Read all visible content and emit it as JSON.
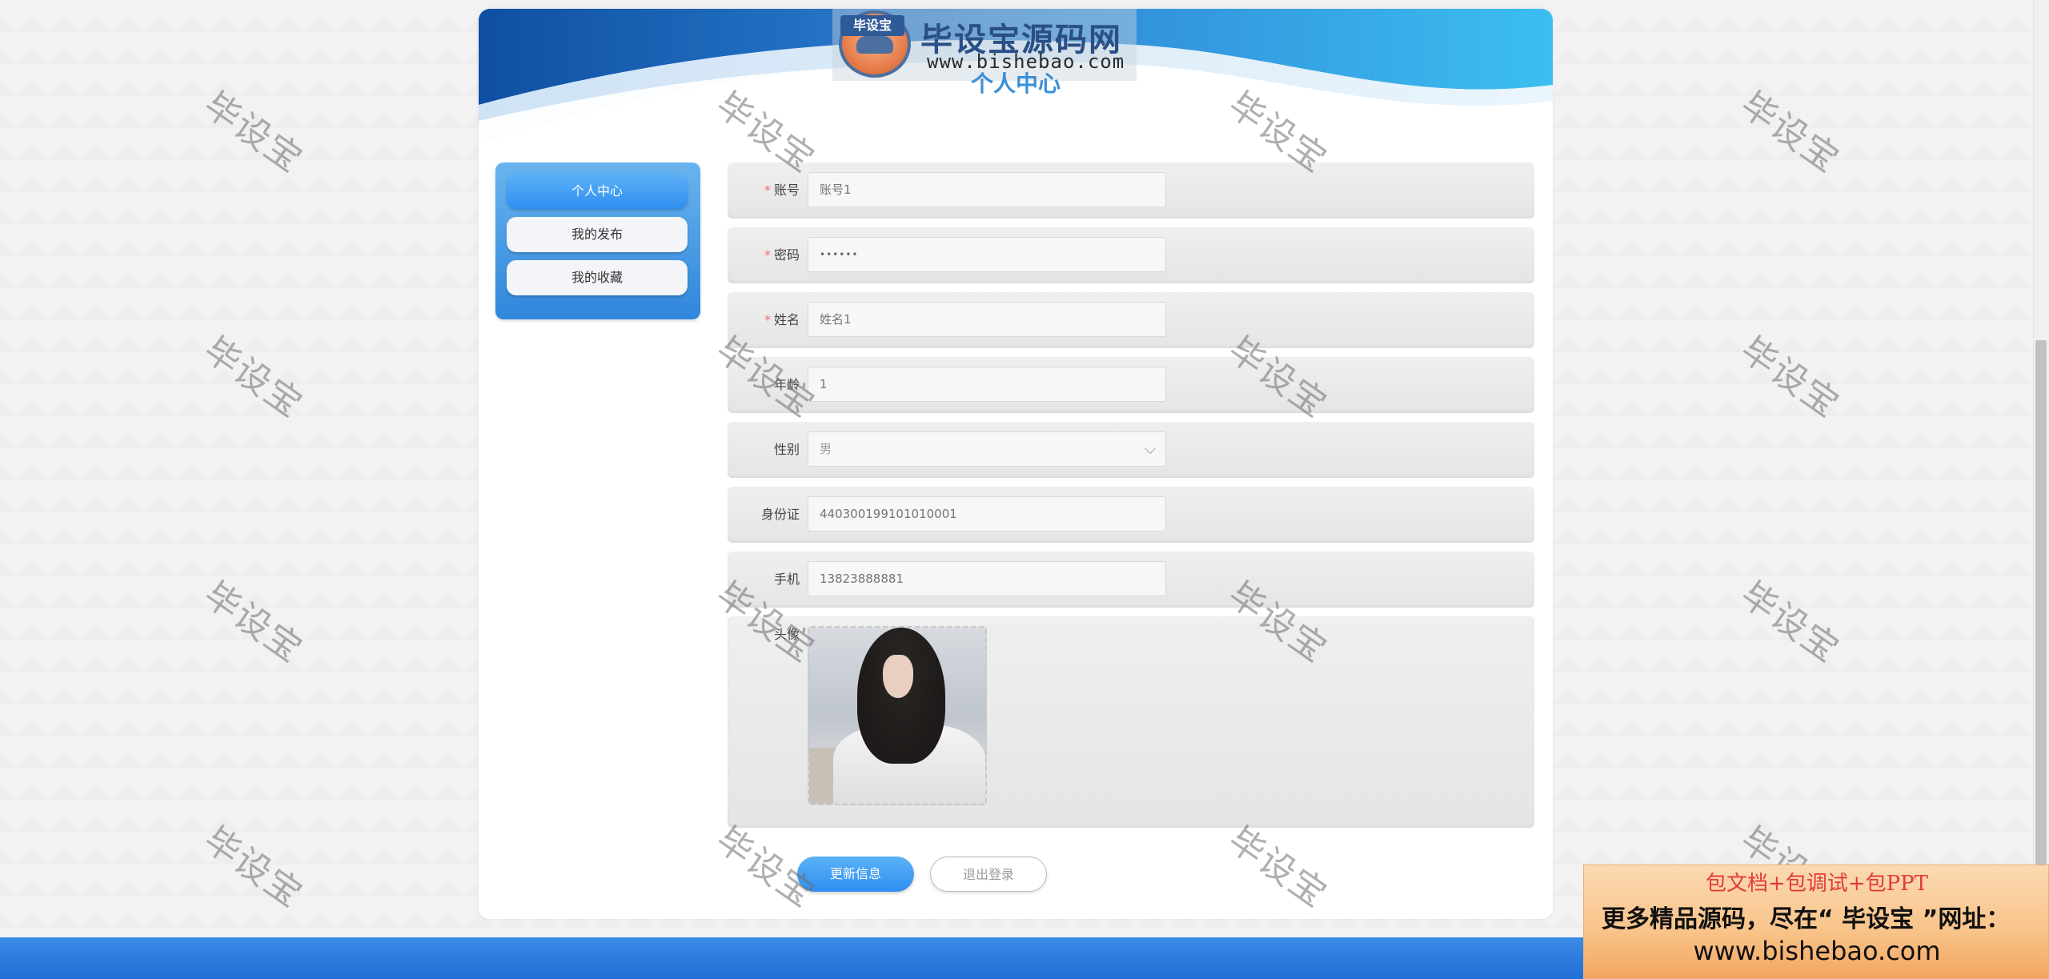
{
  "logo": {
    "tag": "毕设宝",
    "title": "毕设宝源码网",
    "url": "www.bishebao.com"
  },
  "page_title": "个人中心",
  "sidebar": {
    "items": [
      {
        "label": "个人中心",
        "active": true
      },
      {
        "label": "我的发布",
        "active": false
      },
      {
        "label": "我的收藏",
        "active": false
      }
    ]
  },
  "form": {
    "account": {
      "label": "账号",
      "required": true,
      "value": "账号1"
    },
    "password": {
      "label": "密码",
      "required": true,
      "value": "••••••"
    },
    "name": {
      "label": "姓名",
      "required": true,
      "value": "姓名1"
    },
    "age": {
      "label": "年龄",
      "required": false,
      "value": "1"
    },
    "gender": {
      "label": "性别",
      "required": false,
      "value": "男"
    },
    "idcard": {
      "label": "身份证",
      "required": false,
      "value": "440300199101010001"
    },
    "phone": {
      "label": "手机",
      "required": false,
      "value": "13823888881"
    },
    "avatar": {
      "label": "头像"
    }
  },
  "actions": {
    "update_label": "更新信息",
    "logout_label": "退出登录"
  },
  "watermark_text": "毕设宝",
  "promo": {
    "line1": "包文档+包调试+包PPT",
    "line2": "更多精品源码，尽在“ 毕设宝 ”网址：",
    "line3": "www.bishebao.com"
  },
  "colors": {
    "accent": "#2f8ff0",
    "footer": "#1f6fd6",
    "required": "#f56c6c",
    "promo_red": "#e23a3a"
  }
}
